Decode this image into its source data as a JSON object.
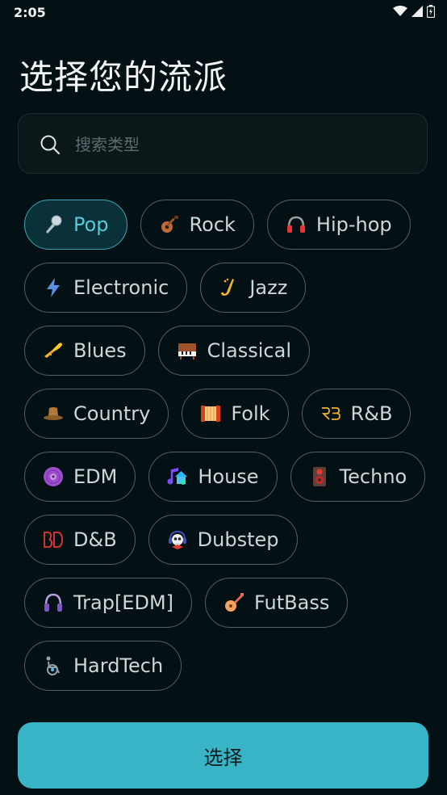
{
  "status_bar": {
    "time": "2:05",
    "icons": [
      "wifi-icon",
      "signal-icon",
      "battery-icon"
    ]
  },
  "title": "选择您的流派",
  "search": {
    "placeholder": "搜索类型",
    "value": ""
  },
  "genres": [
    {
      "label": "Pop",
      "icon": "microphone-icon",
      "selected": true
    },
    {
      "label": "Rock",
      "icon": "guitar-icon",
      "selected": false
    },
    {
      "label": "Hip-hop",
      "icon": "headphones-icon",
      "selected": false
    },
    {
      "label": "Electronic",
      "icon": "lightning-icon",
      "selected": false
    },
    {
      "label": "Jazz",
      "icon": "saxophone-icon",
      "selected": false
    },
    {
      "label": "Blues",
      "icon": "trumpet-icon",
      "selected": false
    },
    {
      "label": "Classical",
      "icon": "piano-icon",
      "selected": false
    },
    {
      "label": "Country",
      "icon": "cowboy-hat-icon",
      "selected": false
    },
    {
      "label": "Folk",
      "icon": "accordion-icon",
      "selected": false
    },
    {
      "label": "R&B",
      "icon": "rb-logo-icon",
      "selected": false
    },
    {
      "label": "EDM",
      "icon": "vinyl-icon",
      "selected": false
    },
    {
      "label": "House",
      "icon": "music-house-icon",
      "selected": false
    },
    {
      "label": "Techno",
      "icon": "speaker-icon",
      "selected": false
    },
    {
      "label": "D&B",
      "icon": "db-logo-icon",
      "selected": false
    },
    {
      "label": "Dubstep",
      "icon": "skull-headphones-icon",
      "selected": false
    },
    {
      "label": "Trap[EDM]",
      "icon": "headphones-purple-icon",
      "selected": false
    },
    {
      "label": "FutBass",
      "icon": "lute-icon",
      "selected": false
    },
    {
      "label": "HardTech",
      "icon": "wheelchair-icon",
      "selected": false
    }
  ],
  "button": {
    "label": "选择"
  },
  "colors": {
    "background": "#041114",
    "accent": "#39b4c6",
    "selected_text": "#56c9dd",
    "chip_border": "#56605f"
  }
}
